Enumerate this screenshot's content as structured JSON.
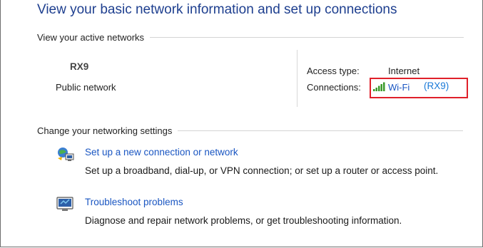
{
  "page_title": "View your basic network information and set up connections",
  "active_networks": {
    "section_label": "View your active networks",
    "network_name": "RX9",
    "network_category": "Public network",
    "access_type_label": "Access type:",
    "access_type_value": "Internet",
    "connections_label": "Connections:",
    "connection_link": "Wi-Fi",
    "connection_suffix": "(RX9)",
    "connection_icon": "wifi-signal-icon",
    "highlight_color": "#e0202a"
  },
  "networking_settings": {
    "section_label": "Change your networking settings",
    "tasks": [
      {
        "icon": "network-setup-icon",
        "link": "Set up a new connection or network",
        "description": "Set up a broadband, dial-up, or VPN connection; or set up a router or access point."
      },
      {
        "icon": "troubleshoot-icon",
        "link": "Troubleshoot problems",
        "description": "Diagnose and repair network problems, or get troubleshooting information."
      }
    ]
  },
  "colors": {
    "title": "#1e3f8f",
    "link": "#1a56c2"
  }
}
